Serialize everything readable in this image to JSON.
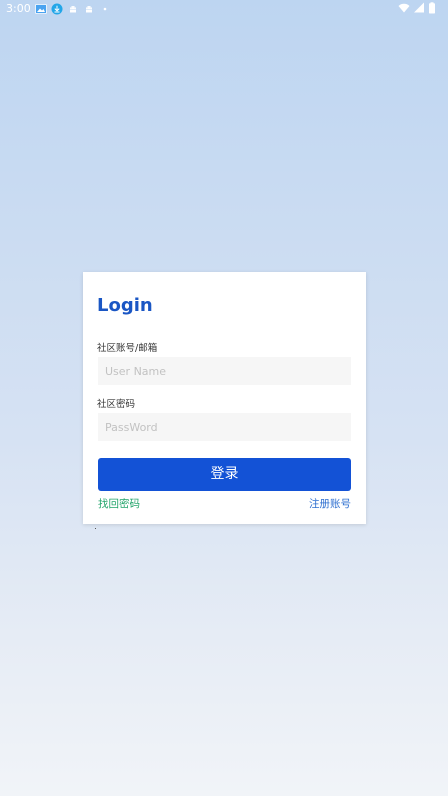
{
  "status_bar": {
    "time": "3:00",
    "left_icons": [
      "gallery-icon",
      "download-icon",
      "android-icon",
      "android-icon",
      "dot-icon"
    ],
    "right_icons": [
      "wifi-icon",
      "signal-icon",
      "battery-icon"
    ]
  },
  "login_card": {
    "title": "Login",
    "account_label": "社区账号/邮箱",
    "account_placeholder": "User Name",
    "account_value": "",
    "password_label": "社区密码",
    "password_placeholder": "PassWord",
    "password_value": "",
    "login_button": "登录",
    "forgot_link": "找回密码",
    "register_link": "注册账号"
  },
  "colors": {
    "title": "#1a56c4",
    "button": "#1352d6",
    "forgot_link": "#21a46a",
    "register_link": "#2e6fd0",
    "input_bg": "#f6f6f6"
  }
}
